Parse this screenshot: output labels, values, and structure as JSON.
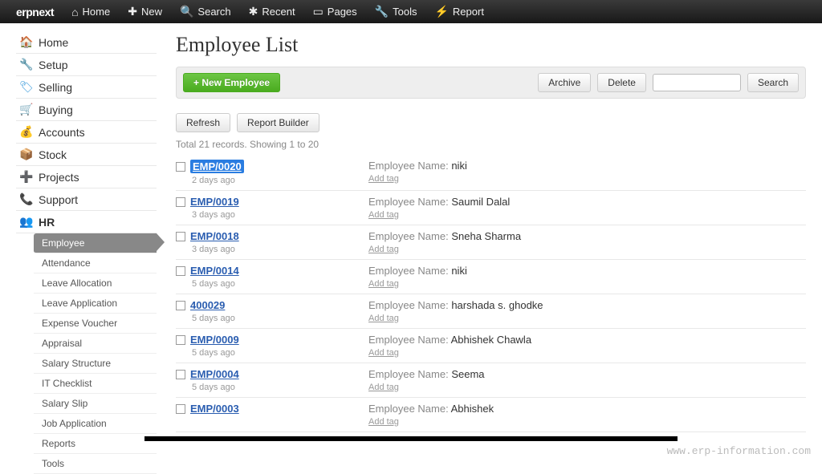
{
  "brand": "erpnext",
  "topnav": [
    {
      "label": "Home"
    },
    {
      "label": "New"
    },
    {
      "label": "Search"
    },
    {
      "label": "Recent"
    },
    {
      "label": "Pages"
    },
    {
      "label": "Tools"
    },
    {
      "label": "Report"
    }
  ],
  "modules": [
    {
      "label": "Home"
    },
    {
      "label": "Setup"
    },
    {
      "label": "Selling"
    },
    {
      "label": "Buying"
    },
    {
      "label": "Accounts"
    },
    {
      "label": "Stock"
    },
    {
      "label": "Projects"
    },
    {
      "label": "Support"
    },
    {
      "label": "HR"
    }
  ],
  "hr_submenu": [
    "Employee",
    "Attendance",
    "Leave Allocation",
    "Leave Application",
    "Expense Voucher",
    "Appraisal",
    "Salary Structure",
    "IT Checklist",
    "Salary Slip",
    "Job Application",
    "Reports",
    "Tools"
  ],
  "page_title": "Employee List",
  "buttons": {
    "new_employee": "+ New Employee",
    "archive": "Archive",
    "delete": "Delete",
    "search": "Search",
    "refresh": "Refresh",
    "report_builder": "Report Builder"
  },
  "search_placeholder": "",
  "records_info": "Total 21 records. Showing 1 to 20",
  "name_label": "Employee Name:",
  "add_tag_label": "Add tag",
  "rows": [
    {
      "id": "EMP/0020",
      "age": "2 days ago",
      "name": "niki",
      "highlighted": true
    },
    {
      "id": "EMP/0019",
      "age": "3 days ago",
      "name": "Saumil Dalal"
    },
    {
      "id": "EMP/0018",
      "age": "3 days ago",
      "name": "Sneha Sharma"
    },
    {
      "id": "EMP/0014",
      "age": "5 days ago",
      "name": "niki"
    },
    {
      "id": "400029",
      "age": "5 days ago",
      "name": "harshada s. ghodke"
    },
    {
      "id": "EMP/0009",
      "age": "5 days ago",
      "name": "Abhishek Chawla"
    },
    {
      "id": "EMP/0004",
      "age": "5 days ago",
      "name": "Seema"
    },
    {
      "id": "EMP/0003",
      "age": "",
      "name": "Abhishek"
    }
  ],
  "footer_url": "www.erp-information.com"
}
